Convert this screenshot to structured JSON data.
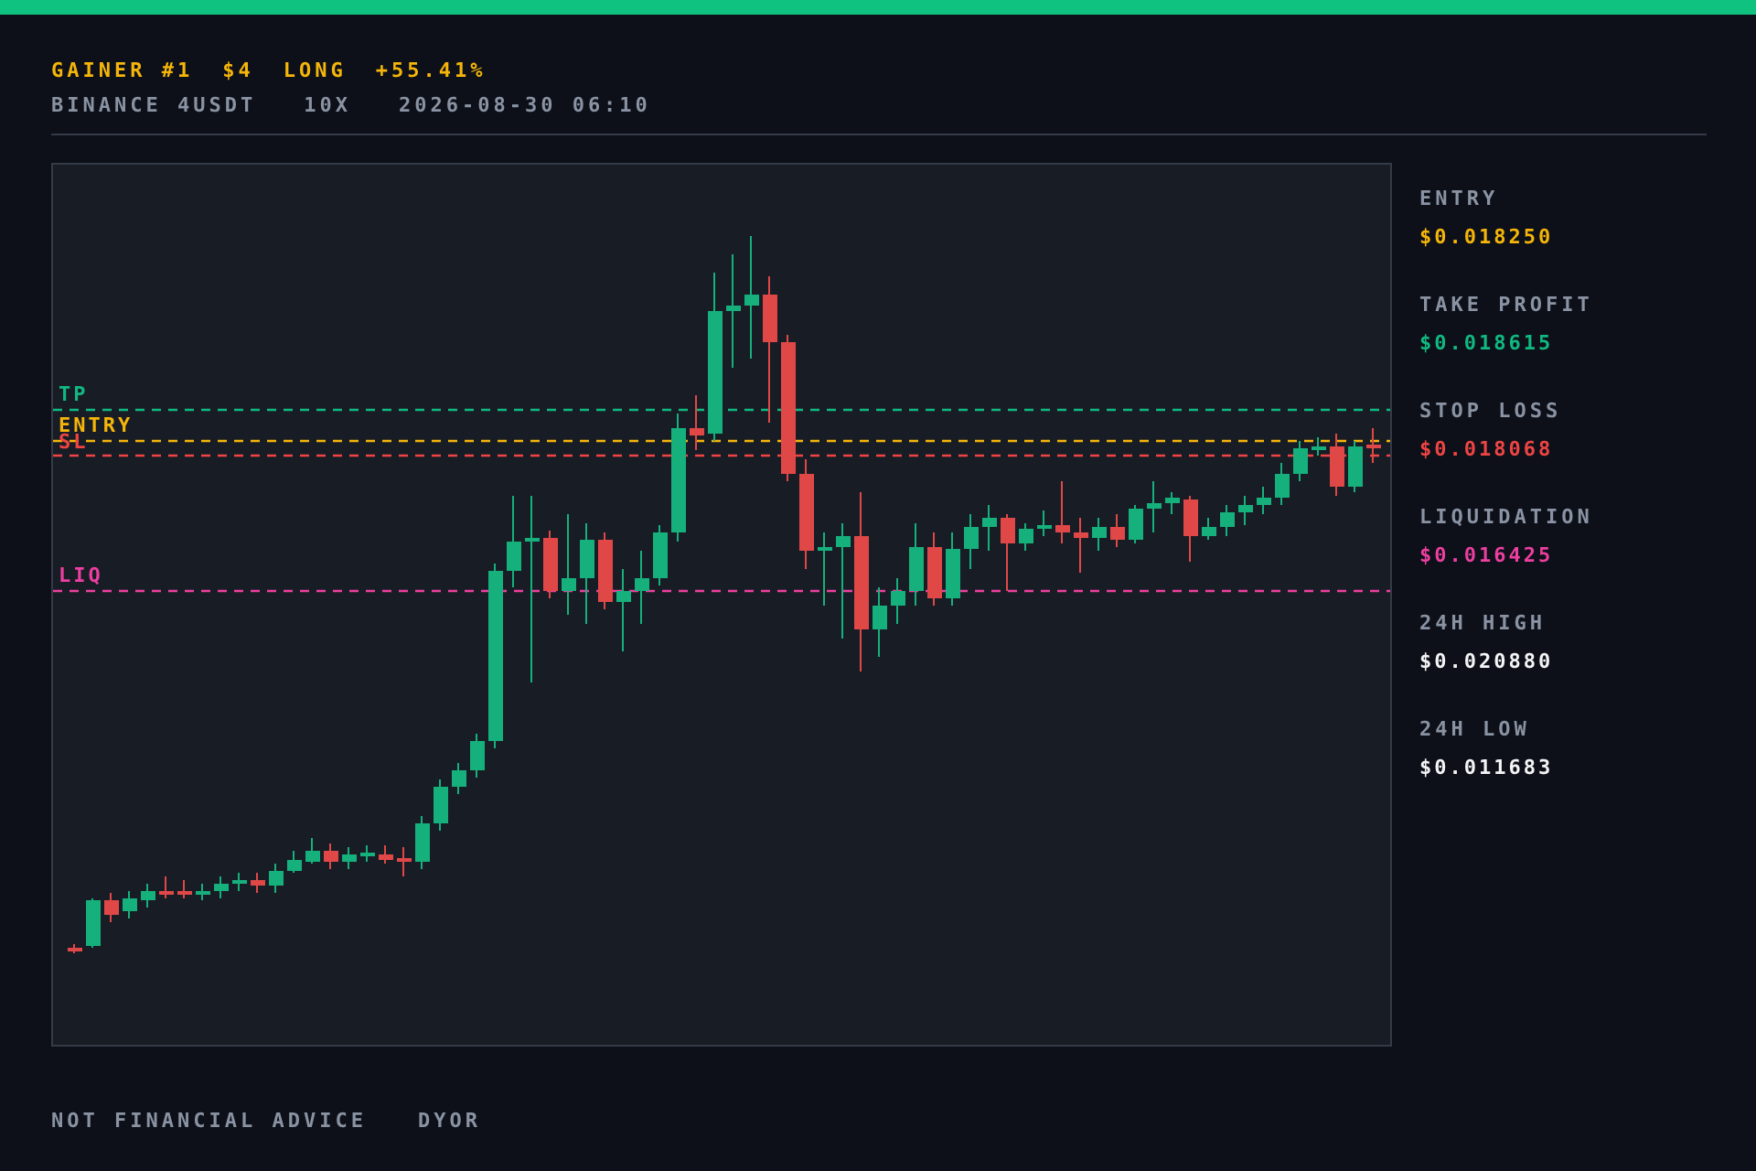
{
  "header": {
    "title": [
      "GAINER #1",
      "$4",
      "LONG",
      "+55.41%"
    ],
    "meta": [
      "BINANCE 4USDT",
      "10X",
      "2026-08-30 06:10"
    ]
  },
  "chart": {
    "levels": [
      {
        "label": "TP",
        "kind": "tp",
        "color": "#10b981"
      },
      {
        "label": "ENTRY",
        "kind": "entry",
        "color": "#f5b50a"
      },
      {
        "label": "SL",
        "kind": "sl",
        "color": "#ef4444"
      },
      {
        "label": "LIQ",
        "kind": "liq",
        "color": "#ec3fa0"
      }
    ]
  },
  "stats": [
    {
      "label": "ENTRY",
      "value": "$0.018250",
      "color": "#f5b50a"
    },
    {
      "label": "TAKE PROFIT",
      "value": "$0.018615",
      "color": "#10b981"
    },
    {
      "label": "STOP LOSS",
      "value": "$0.018068",
      "color": "#ef4444"
    },
    {
      "label": "LIQUIDATION",
      "value": "$0.016425",
      "color": "#ec3fa0"
    },
    {
      "label": "24H HIGH",
      "value": "$0.020880",
      "color": "#f3f4f6"
    },
    {
      "label": "24H LOW",
      "value": "$0.011683",
      "color": "#f3f4f6"
    }
  ],
  "footer": [
    "NOT FINANCIAL ADVICE",
    "DYOR"
  ]
}
